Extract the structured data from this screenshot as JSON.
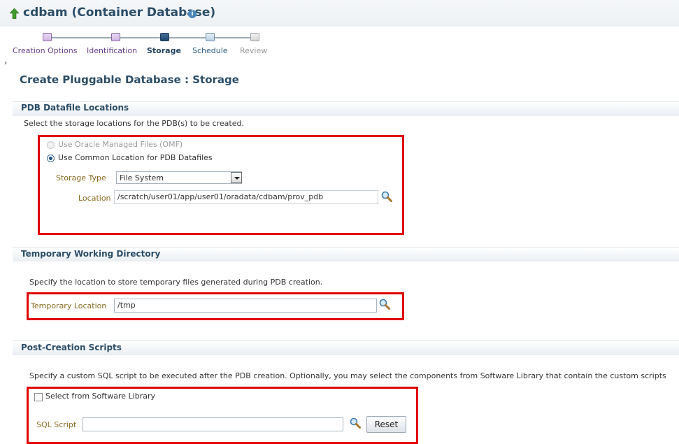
{
  "header": {
    "title": "cdbam (Container Database)",
    "info_icon": "info-icon",
    "home_icon": "home-icon"
  },
  "train": {
    "steps": [
      {
        "label": "Creation Options",
        "state": "done"
      },
      {
        "label": "Identification",
        "state": "done"
      },
      {
        "label": "Storage",
        "state": "current"
      },
      {
        "label": "Schedule",
        "state": "next"
      },
      {
        "label": "Review",
        "state": "future"
      }
    ]
  },
  "page": {
    "title": "Create Pluggable Database : Storage"
  },
  "datafiles": {
    "section_title": "PDB Datafile Locations",
    "description": "Select the storage locations for the PDB(s) to be created.",
    "option_omf": "Use Oracle Managed Files (OMF)",
    "option_common": "Use Common Location for PDB Datafiles",
    "selected_option": "Use Common Location for PDB Datafiles",
    "storage_type_label": "Storage Type",
    "storage_type_value": "File System",
    "location_label": "Location",
    "location_value": "/scratch/user01/app/user01/oradata/cdbam/prov_pdb"
  },
  "temp": {
    "section_title": "Temporary Working Directory",
    "description": "Specify the location to store temporary files generated during PDB creation.",
    "location_label": "Temporary Location",
    "location_value": "/tmp"
  },
  "scripts": {
    "section_title": "Post-Creation Scripts",
    "description": "Specify a custom SQL script to be executed after the PDB creation. Optionally, you may select the components from Software Library that contain the custom scripts",
    "checkbox_label": "Select from Software Library",
    "checkbox_checked": false,
    "sql_script_label": "SQL Script",
    "sql_script_value": "",
    "reset_label": "Reset"
  },
  "colors": {
    "highlight_border": "#e00000",
    "title_blue": "#2b4d67",
    "field_label": "#8a6a1e"
  }
}
